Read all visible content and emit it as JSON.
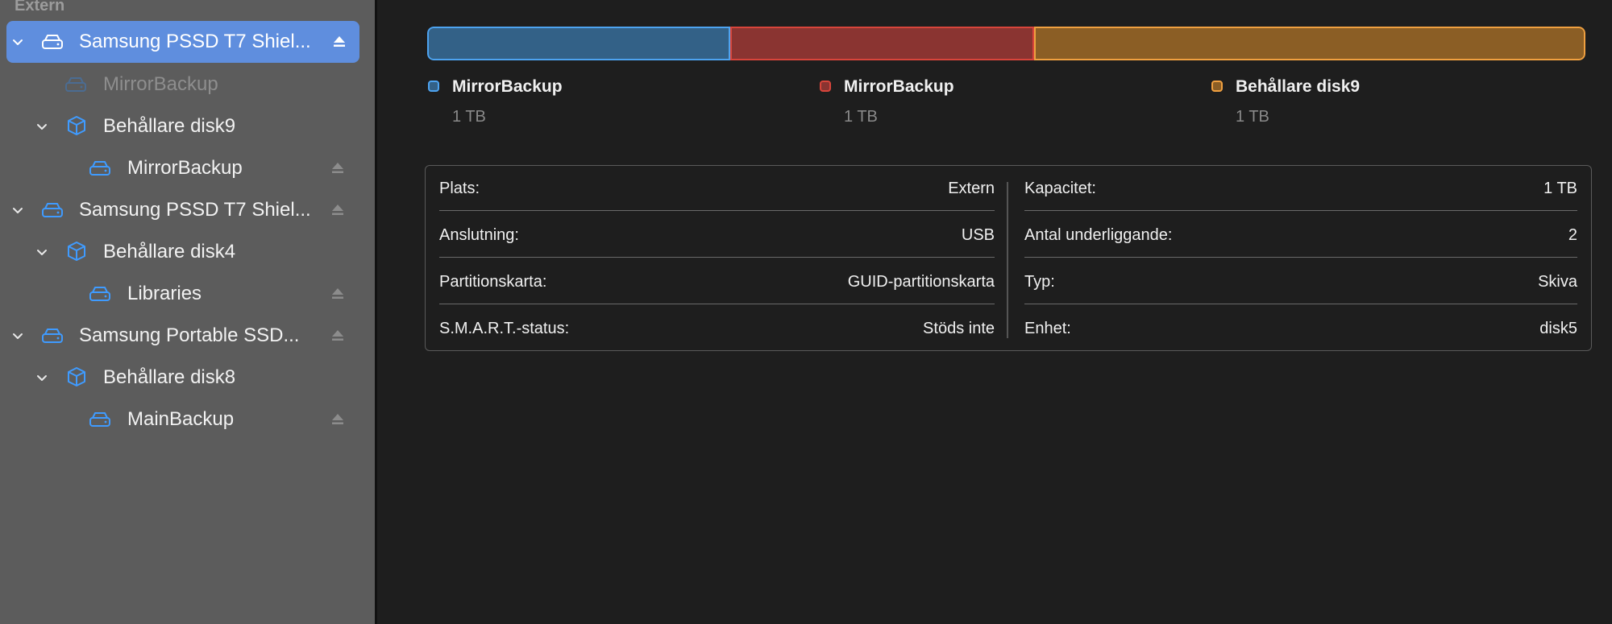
{
  "sidebar": {
    "section_header": "Extern",
    "items": [
      {
        "label": "Samsung PSSD T7 Shiel...",
        "icon": "drive-icon",
        "selected": true
      },
      {
        "label": "MirrorBackup",
        "icon": "volume-icon",
        "dimmed": true
      },
      {
        "label": "Behållare disk9",
        "icon": "container-icon"
      },
      {
        "label": "MirrorBackup",
        "icon": "volume-icon"
      },
      {
        "label": "Samsung PSSD T7 Shiel...",
        "icon": "drive-icon"
      },
      {
        "label": "Behållare disk4",
        "icon": "container-icon"
      },
      {
        "label": "Libraries",
        "icon": "volume-icon"
      },
      {
        "label": "Samsung Portable SSD...",
        "icon": "drive-icon"
      },
      {
        "label": "Behållare disk8",
        "icon": "container-icon"
      },
      {
        "label": "MainBackup",
        "icon": "volume-icon"
      }
    ]
  },
  "usage": {
    "segments": [
      {
        "name": "MirrorBackup",
        "size": "1 TB",
        "color": "#4da3f0",
        "fraction": 0.262
      },
      {
        "name": "MirrorBackup",
        "size": "1 TB",
        "color": "#d8453b",
        "fraction": 0.262
      },
      {
        "name": "Behållare disk9",
        "size": "1 TB",
        "color": "#f0a040",
        "fraction": 0.476
      }
    ]
  },
  "info": {
    "left": [
      {
        "key": "Plats:",
        "value": "Extern"
      },
      {
        "key": "Anslutning:",
        "value": "USB"
      },
      {
        "key": "Partitionskarta:",
        "value": "GUID-partitionskarta"
      },
      {
        "key": "S.M.A.R.T.-status:",
        "value": "Stöds inte"
      }
    ],
    "right": [
      {
        "key": "Kapacitet:",
        "value": "1 TB"
      },
      {
        "key": "Antal underliggande:",
        "value": "2"
      },
      {
        "key": "Typ:",
        "value": "Skiva"
      },
      {
        "key": "Enhet:",
        "value": "disk5"
      }
    ]
  }
}
